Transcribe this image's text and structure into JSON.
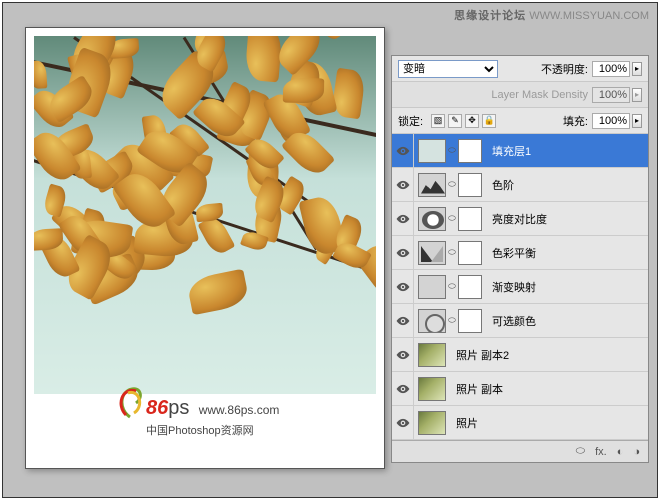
{
  "watermark": {
    "forum": "思缘设计论坛",
    "url": "WWW.MISSYUAN.COM"
  },
  "logo": {
    "brand_num": "86",
    "brand_ps": "ps",
    "url": "www.86ps.com",
    "tagline": "中国Photoshop资源网"
  },
  "panel": {
    "blend_mode": "变暗",
    "opacity_label": "不透明度:",
    "opacity_value": "100%",
    "mask_density_label": "Layer Mask Density",
    "mask_density_value": "100%",
    "lock_label": "锁定:",
    "fill_label": "填充:",
    "fill_value": "100%"
  },
  "layers": [
    {
      "name": "填充层1",
      "type": "solidfill",
      "selected": true
    },
    {
      "name": "色阶",
      "type": "levels"
    },
    {
      "name": "亮度对比度",
      "type": "bc"
    },
    {
      "name": "色彩平衡",
      "type": "cb"
    },
    {
      "name": "渐变映射",
      "type": "gm"
    },
    {
      "name": "可选颜色",
      "type": "sc"
    },
    {
      "name": "照片 副本2",
      "type": "photo"
    },
    {
      "name": "照片 副本",
      "type": "photo"
    },
    {
      "name": "照片",
      "type": "photo"
    }
  ],
  "footer": {
    "fx": "fx."
  }
}
